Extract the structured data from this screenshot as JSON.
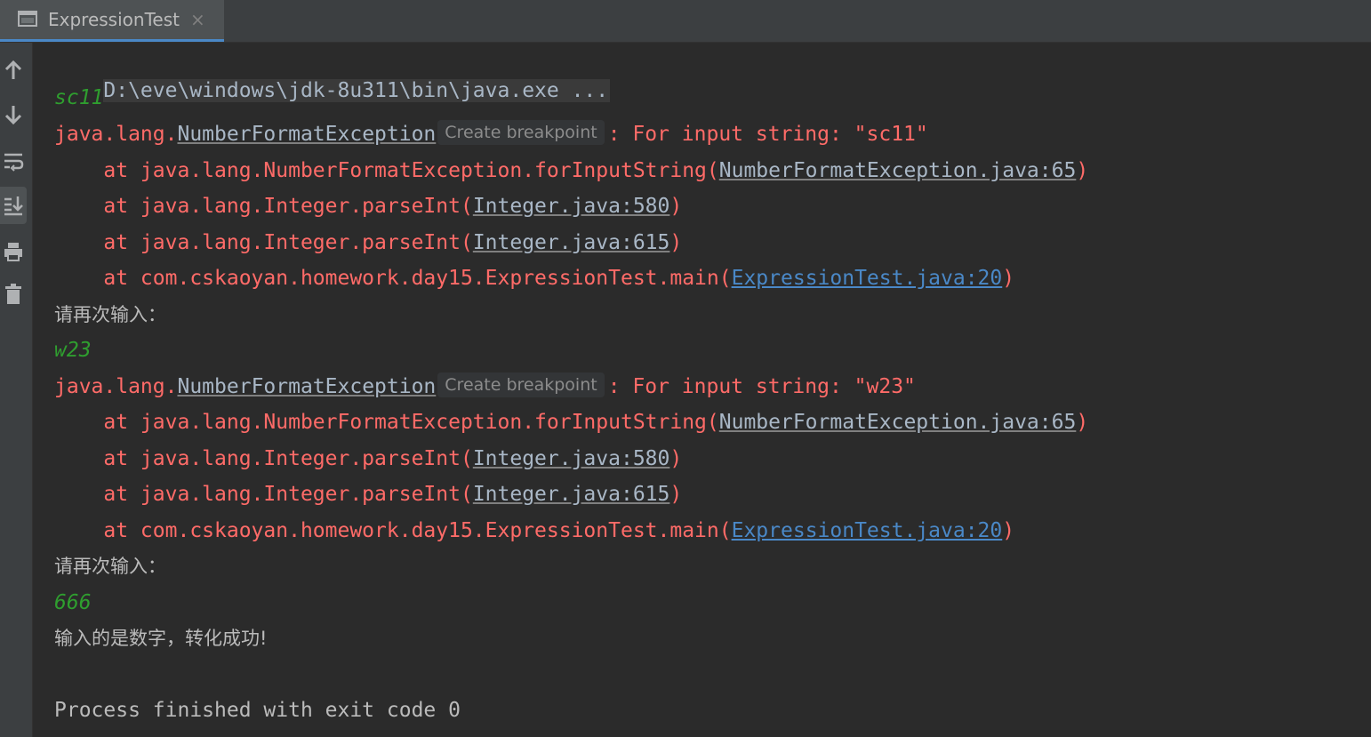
{
  "tab": {
    "title": "ExpressionTest",
    "close_glyph": "×",
    "icon": "console-icon"
  },
  "toolbar": {
    "buttons": [
      {
        "name": "up-arrow-icon",
        "tooltip": ""
      },
      {
        "name": "down-arrow-icon",
        "tooltip": ""
      },
      {
        "name": "soft-wrap-icon",
        "tooltip": ""
      },
      {
        "name": "scroll-to-end-icon",
        "tooltip": ""
      },
      {
        "name": "print-icon",
        "tooltip": ""
      },
      {
        "name": "trash-icon",
        "tooltip": ""
      }
    ]
  },
  "console": {
    "command": "D:\\eve\\windows\\jdk-8u311\\bin\\java.exe ...",
    "blocks": [
      {
        "input": "sc11",
        "exception_prefix": "java.lang.",
        "exception_class": "NumberFormatException",
        "hint": "Create breakpoint",
        "exception_msg": ": For input string: \"sc11\"",
        "frames": [
          {
            "prefix": "    at java.lang.NumberFormatException.forInputString(",
            "link": "NumberFormatException.java:65",
            "suffix": ")"
          },
          {
            "prefix": "    at java.lang.Integer.parseInt(",
            "link": "Integer.java:580",
            "suffix": ")"
          },
          {
            "prefix": "    at java.lang.Integer.parseInt(",
            "link": "Integer.java:615",
            "suffix": ")"
          },
          {
            "prefix": "    at com.cskaoyan.homework.day15.ExpressionTest.main(",
            "link": "ExpressionTest.java:20",
            "suffix": ")"
          }
        ],
        "prompt": "请再次输入："
      },
      {
        "input": "w23",
        "exception_prefix": "java.lang.",
        "exception_class": "NumberFormatException",
        "hint": "Create breakpoint",
        "exception_msg": ": For input string: \"w23\"",
        "frames": [
          {
            "prefix": "    at java.lang.NumberFormatException.forInputString(",
            "link": "NumberFormatException.java:65",
            "suffix": ")"
          },
          {
            "prefix": "    at java.lang.Integer.parseInt(",
            "link": "Integer.java:580",
            "suffix": ")"
          },
          {
            "prefix": "    at java.lang.Integer.parseInt(",
            "link": "Integer.java:615",
            "suffix": ")"
          },
          {
            "prefix": "    at com.cskaoyan.homework.day15.ExpressionTest.main(",
            "link": "ExpressionTest.java:20",
            "suffix": ")"
          }
        ],
        "prompt": "请再次输入："
      }
    ],
    "final_input": "666",
    "success_msg": "输入的是数字，转化成功!",
    "finish": "Process finished with exit code 0"
  },
  "colors": {
    "background": "#2b2b2b",
    "error": "#ff6b68",
    "input": "#2f9e2f",
    "link_blue": "#4a88c7",
    "text": "#bbbbbb"
  }
}
